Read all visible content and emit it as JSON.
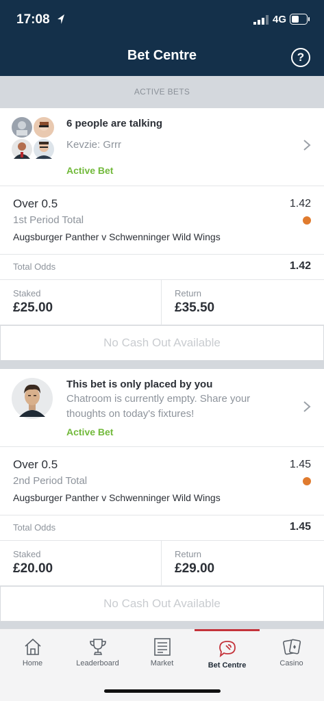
{
  "status_bar": {
    "time": "17:08",
    "network": "4G"
  },
  "header": {
    "title": "Bet Centre",
    "help_label": "?"
  },
  "section": {
    "label": "ACTIVE BETS"
  },
  "bets": [
    {
      "chat": {
        "heading": "6 people are talking",
        "message": "Kevzie: Grrr",
        "status": "Active Bet"
      },
      "selection": {
        "market": "Over 0.5",
        "market_type": "1st Period Total",
        "event": "Augsburger Panther v Schwenninger Wild Wings",
        "odds": "1.42"
      },
      "total_odds_label": "Total Odds",
      "total_odds": "1.42",
      "staked_label": "Staked",
      "staked": "£25.00",
      "return_label": "Return",
      "return": "£35.50",
      "cash_out": "No Cash Out Available"
    },
    {
      "chat": {
        "heading": "This bet is only placed by you",
        "message_line1": "Chatroom is currently empty. Share your",
        "message_line2": "thoughts on today's fixtures!",
        "status": "Active Bet"
      },
      "selection": {
        "market": "Over 0.5",
        "market_type": "2nd Period Total",
        "event": "Augsburger Panther v Schwenninger Wild Wings",
        "odds": "1.45"
      },
      "total_odds_label": "Total Odds",
      "total_odds": "1.45",
      "staked_label": "Staked",
      "staked": "£20.00",
      "return_label": "Return",
      "return": "£29.00",
      "cash_out": "No Cash Out Available"
    }
  ],
  "nav": {
    "items": [
      {
        "label": "Home",
        "icon": "home-icon"
      },
      {
        "label": "Leaderboard",
        "icon": "trophy-icon"
      },
      {
        "label": "Market",
        "icon": "list-icon"
      },
      {
        "label": "Bet Centre",
        "icon": "chat-icon",
        "active": true
      },
      {
        "label": "Casino",
        "icon": "cards-icon"
      }
    ]
  },
  "colors": {
    "header_bg": "#14304a",
    "active_green": "#71b93a",
    "odds_dot": "#e07b2e",
    "nav_active": "#c4323a"
  }
}
